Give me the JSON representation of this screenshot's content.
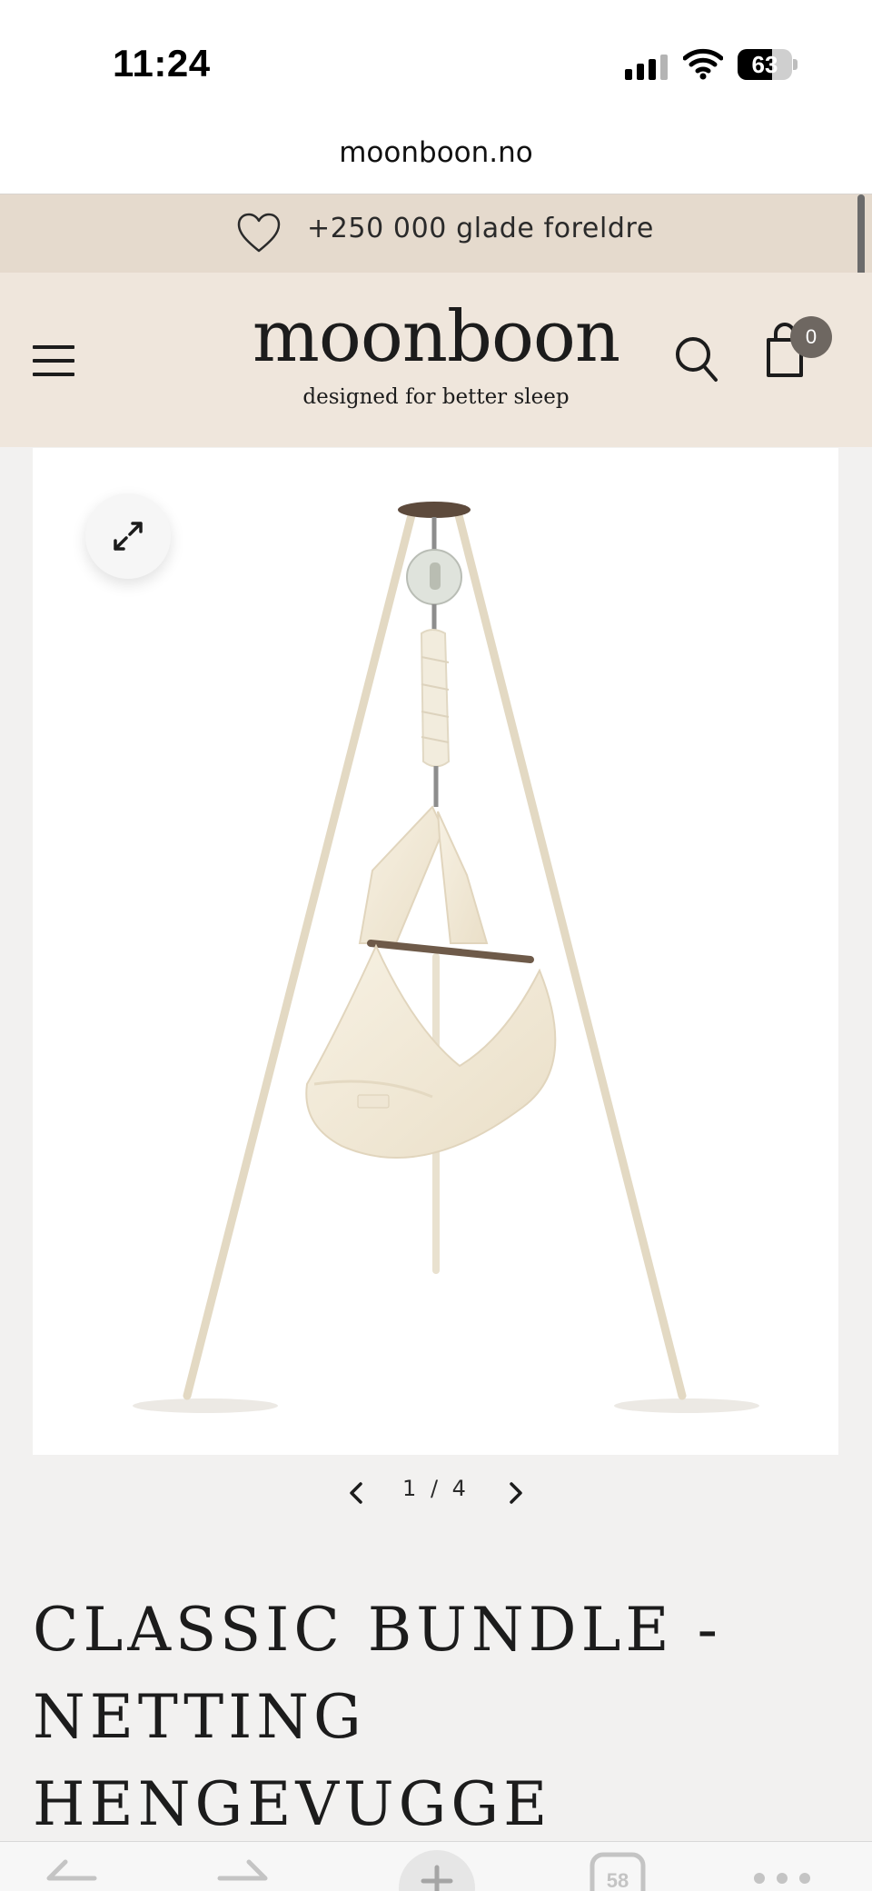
{
  "status_bar": {
    "time": "11:24",
    "battery_level": "63",
    "battery_fraction": 0.63,
    "signal_bars_active": 3,
    "signal_bars_total": 4
  },
  "browser": {
    "url": "moonboon.no"
  },
  "promo": {
    "icon": "heart-icon",
    "text": "+250 000 glade foreldre"
  },
  "header": {
    "menu_icon": "hamburger-menu-icon",
    "logo_text": "moonboon",
    "tagline": "designed for better sleep",
    "search_icon": "search-icon",
    "cart_icon": "shopping-bag-icon",
    "cart_count": "0"
  },
  "gallery": {
    "expand_icon": "expand-arrows-icon",
    "image_subject": "baby-hammock-on-tripod-stand",
    "current": "1",
    "separator": "/",
    "total": "4",
    "counter": "1 / 4"
  },
  "product": {
    "title": "CLASSIC BUNDLE - NETTING HENGEVUGGE"
  },
  "toolbar": {
    "icons": [
      "back-arrow-icon",
      "forward-arrow-icon",
      "new-tab-plus-icon",
      "tabs-icon",
      "more-options-icon"
    ],
    "tabs_count": "58"
  },
  "colors": {
    "promo_bg": "#e5dacd",
    "header_bg": "#efe6dc",
    "page_bg": "#f2f1f0",
    "text": "#1c1c1c",
    "badge_bg": "#6e6761"
  }
}
